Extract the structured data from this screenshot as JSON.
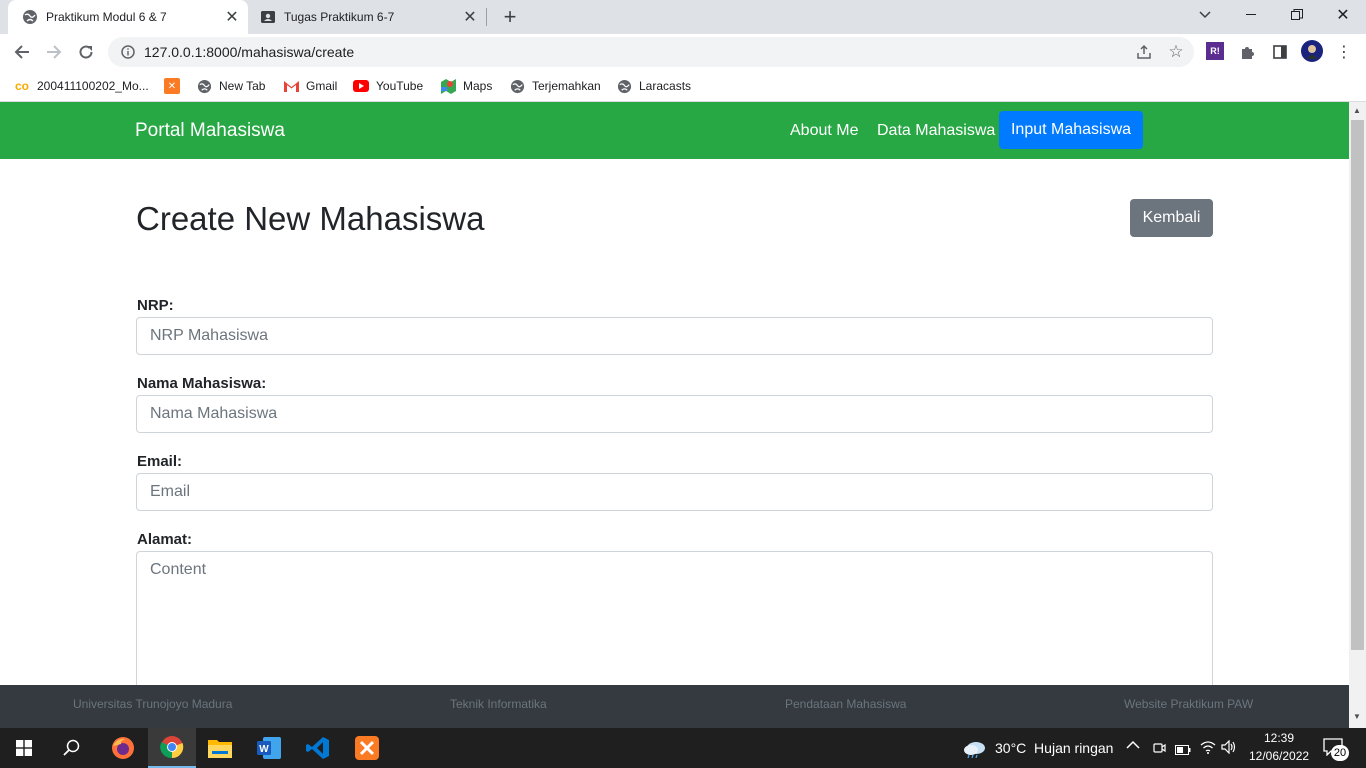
{
  "browser": {
    "tabs": [
      {
        "title": "Praktikum Modul 6 & 7",
        "active": true
      },
      {
        "title": "Tugas Praktikum 6-7",
        "active": false
      }
    ],
    "new_tab_icon": "plus-icon",
    "url": "127.0.0.1:8000/mahasiswa/create",
    "profile_initial": "R!",
    "bookmarks": [
      {
        "label": "200411100202_Mo...",
        "icon": "co-icon"
      },
      {
        "label": "",
        "icon": "xampp-icon"
      },
      {
        "label": "New Tab",
        "icon": "globe-icon"
      },
      {
        "label": "Gmail",
        "icon": "gmail-icon"
      },
      {
        "label": "YouTube",
        "icon": "youtube-icon"
      },
      {
        "label": "Maps",
        "icon": "maps-icon"
      },
      {
        "label": "Terjemahkan",
        "icon": "globe-icon"
      },
      {
        "label": "Laracasts",
        "icon": "globe-icon"
      }
    ]
  },
  "app": {
    "brand": "Portal Mahasiswa",
    "nav": [
      "About Me",
      "Data Mahasiswa",
      "Input Mahasiswa"
    ],
    "page_title": "Create New Mahasiswa",
    "back_button": "Kembali",
    "form": {
      "nrp_label": "NRP:",
      "nrp_placeholder": "NRP Mahasiswa",
      "nama_label": "Nama Mahasiswa:",
      "nama_placeholder": "Nama Mahasiswa",
      "email_label": "Email:",
      "email_placeholder": "Email",
      "alamat_label": "Alamat:",
      "alamat_placeholder": "Content"
    },
    "footer": [
      "Universitas Trunojoyo Madura",
      "Teknik Informatika",
      "Pendataan Mahasiswa",
      "Website Praktikum PAW"
    ],
    "colors": {
      "navbar": "#28a745",
      "active_nav": "#007bff",
      "back_button": "#6c757d",
      "footer": "#343a40"
    }
  },
  "taskbar": {
    "weather": "30°C  Hujan ringan",
    "time": "12:39",
    "date": "12/06/2022",
    "notifications": "20"
  }
}
